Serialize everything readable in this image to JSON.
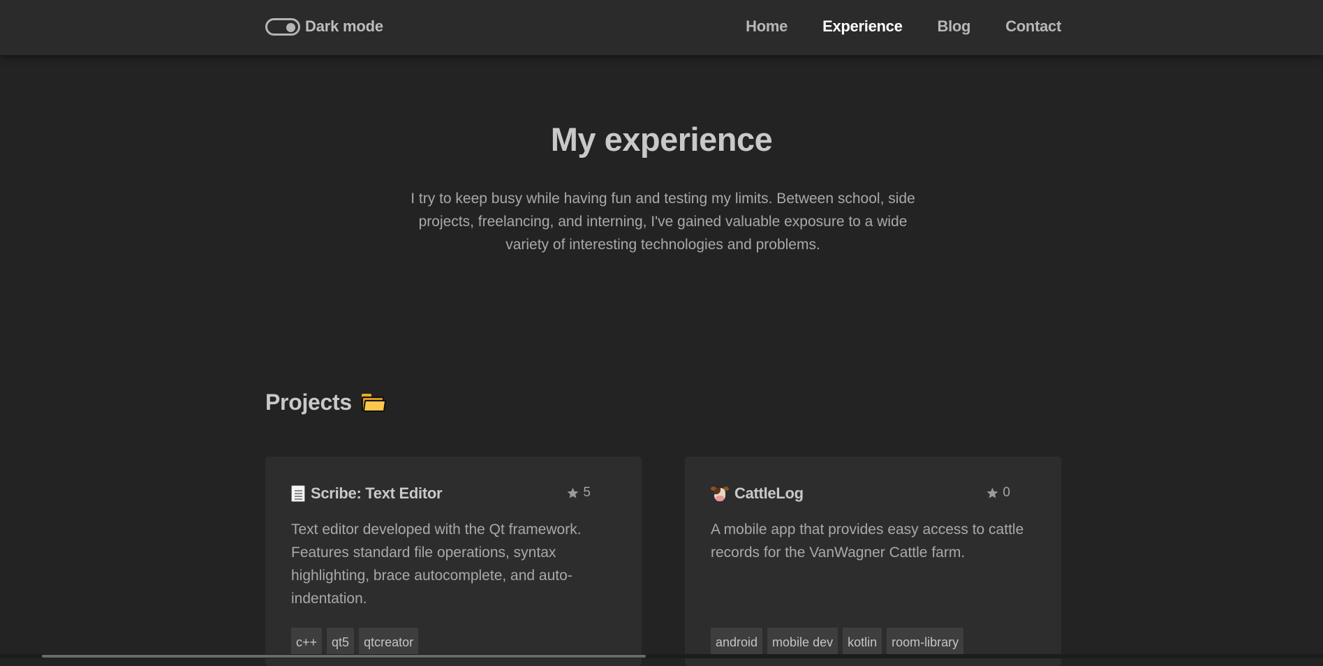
{
  "navbar": {
    "toggle_label": "Dark mode",
    "links": [
      {
        "label": "Home"
      },
      {
        "label": "Experience",
        "active": true
      },
      {
        "label": "Blog"
      },
      {
        "label": "Contact"
      }
    ]
  },
  "hero": {
    "title": "My experience",
    "text": "I try to keep busy while having fun and testing my limits. Between school, side projects, freelancing, and interning, I've gained valuable exposure to a wide variety of interesting technologies and problems."
  },
  "projects": {
    "heading": "Projects",
    "heading_icon": "folder-icon",
    "cards": [
      {
        "icon": "document-icon",
        "title": "Scribe: Text Editor",
        "stars": "5",
        "description": "Text editor developed with the Qt framework. Features standard file operations, syntax highlighting, brace autocomplete, and auto-indentation.",
        "tags": [
          "c++",
          "qt5",
          "qtcreator"
        ]
      },
      {
        "icon": "cow-icon",
        "title": "CattleLog",
        "stars": "0",
        "description": "A mobile app that provides easy access to cattle records for the VanWagner Cattle farm.",
        "tags": [
          "android",
          "mobile dev",
          "kotlin",
          "room-library"
        ]
      }
    ]
  },
  "colors": {
    "background": "#232323",
    "navbar": "#2b2b2b",
    "card": "#2d2d2d",
    "tag": "#3e3e3e",
    "active_link": "#ffffff"
  }
}
